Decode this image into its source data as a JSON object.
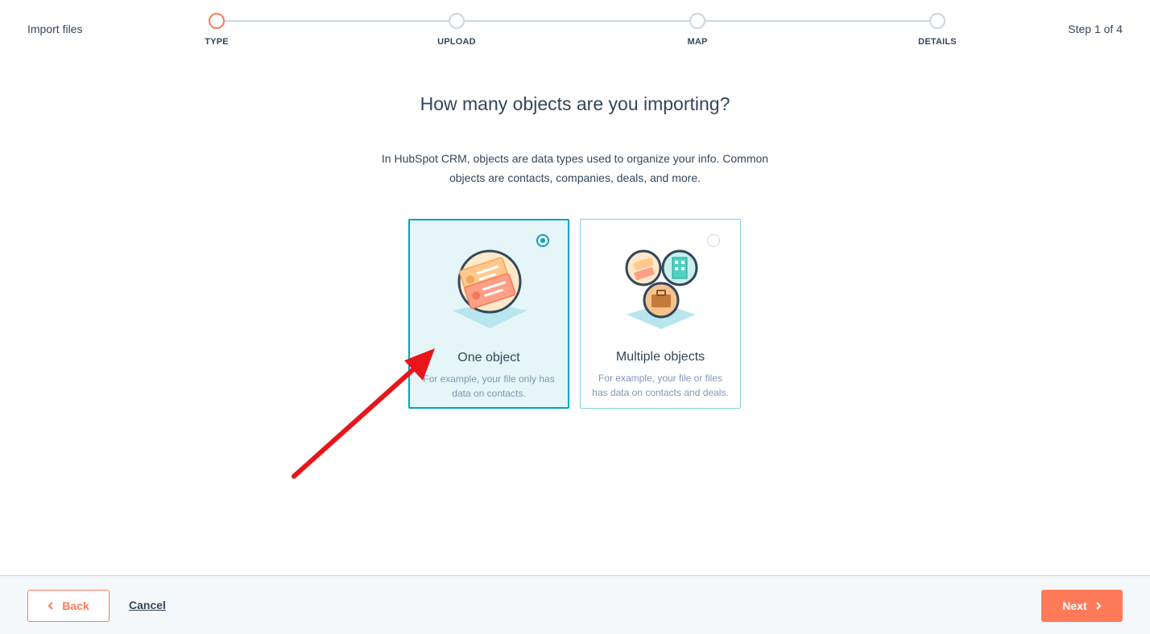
{
  "header": {
    "title": "Import files",
    "step_count": "Step 1 of 4"
  },
  "stepper": {
    "steps": [
      {
        "label": "TYPE",
        "state": "active"
      },
      {
        "label": "UPLOAD",
        "state": "inactive"
      },
      {
        "label": "MAP",
        "state": "inactive"
      },
      {
        "label": "DETAILS",
        "state": "inactive"
      }
    ]
  },
  "main": {
    "question": "How many objects are you importing?",
    "description_line1": "In HubSpot CRM, objects are data types used to organize your info. Common",
    "description_line2": "objects are contacts, companies, deals, and more.",
    "options": [
      {
        "title": "One object",
        "desc_line1": "For example, your file only has",
        "desc_line2": "data on contacts.",
        "selected": true,
        "icon": "contact-cards-icon"
      },
      {
        "title": "Multiple objects",
        "desc_line1": "For example, your file or files",
        "desc_line2": "has data on contacts and deals.",
        "selected": false,
        "icon": "multiple-objects-icon"
      }
    ]
  },
  "footer": {
    "back_label": "Back",
    "cancel_label": "Cancel",
    "next_label": "Next"
  },
  "colors": {
    "accent": "#ff7a59",
    "teal": "#00a4bd",
    "text": "#33475b",
    "annotation_arrow": "#e8151b"
  }
}
